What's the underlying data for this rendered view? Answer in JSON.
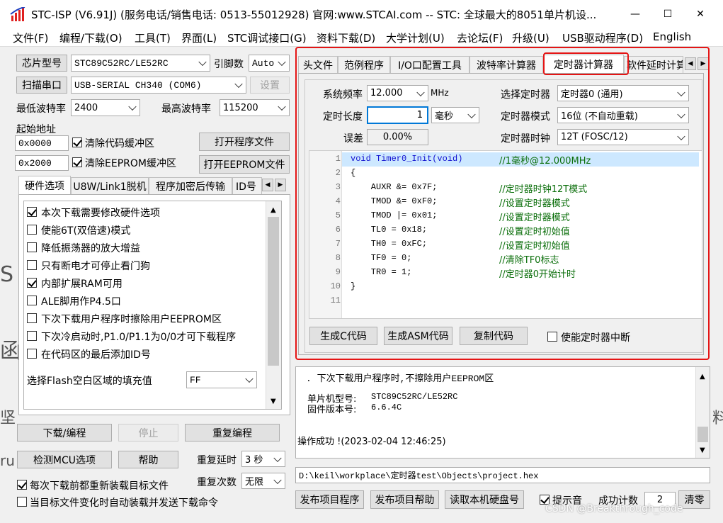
{
  "window": {
    "title": "STC-ISP (V6.91J) (服务电话/销售电话: 0513-55012928) 官网:www.STCAI.com  -- STC: 全球最大的8051单片机设...",
    "minimize": "—",
    "maximize": "☐",
    "close": "✕"
  },
  "menu": [
    "文件(F)",
    "编程/下载(O)",
    "工具(T)",
    "界面(L)",
    "STC调试接口(G)",
    "资料下载(D)",
    "大学计划(U)",
    "去论坛(F)",
    "升级(U)",
    "USB驱动程序(D)",
    "English"
  ],
  "left": {
    "chip_button": "芯片型号",
    "chip_value": "STC89C52RC/LE52RC",
    "pins_label": "引脚数",
    "pins_value": "Auto",
    "scan_button": "扫描串口",
    "port_value": "USB-SERIAL CH340 (COM6)",
    "settings_button": "设置",
    "min_baud_label": "最低波特率",
    "min_baud_value": "2400",
    "max_baud_label": "最高波特率",
    "max_baud_value": "115200",
    "start_addr_label": "起始地址",
    "addr1": "0x0000",
    "clear_code_label": "清除代码缓冲区",
    "open_program_button": "打开程序文件",
    "addr2": "0x2000",
    "clear_eeprom_label": "清除EEPROM缓冲区",
    "open_eeprom_button": "打开EEPROM文件",
    "tabs": [
      "硬件选项",
      "U8W/Link1脱机",
      "程序加密后传输",
      "ID号"
    ],
    "options": [
      {
        "label": "本次下载需要修改硬件选项",
        "checked": true
      },
      {
        "label": "使能6T(双倍速)模式",
        "checked": false
      },
      {
        "label": "降低振荡器的放大增益",
        "checked": false
      },
      {
        "label": "只有断电才可停止看门狗",
        "checked": false
      },
      {
        "label": "内部扩展RAM可用",
        "checked": true
      },
      {
        "label": "ALE脚用作P4.5口",
        "checked": false
      },
      {
        "label": "下次下载用户程序时擦除用户EEPROM区",
        "checked": false
      },
      {
        "label": "下次冷启动时,P1.0/P1.1为0/0才可下载程序",
        "checked": false
      },
      {
        "label": "在代码区的最后添加ID号",
        "checked": false
      }
    ],
    "fill_label": "选择Flash空白区域的填充值",
    "fill_value": "FF",
    "download_button": "下载/编程",
    "stop_button": "停止",
    "repeat_button": "重复编程",
    "check_mcu_button": "检测MCU选项",
    "help_button": "帮助",
    "repeat_delay_label": "重复延时",
    "repeat_delay_value": "3 秒",
    "repeat_count_label": "重复次数",
    "repeat_count_value": "无限",
    "reload_label": "每次下载前都重新装载目标文件",
    "auto_load_label": "当目标文件变化时自动装载并发送下载命令"
  },
  "right": {
    "tabs": [
      "头文件",
      "范例程序",
      "I/O口配置工具",
      "波特率计算器",
      "定时器计算器",
      "软件延时计算器"
    ],
    "sys_freq_label": "系统频率",
    "sys_freq_value": "12.000",
    "freq_unit": "MHz",
    "select_timer_label": "选择定时器",
    "select_timer_value": "定时器0 (通用)",
    "timer_len_label": "定时长度",
    "timer_len_value": "1",
    "timer_len_unit": "毫秒",
    "timer_mode_label": "定时器模式",
    "timer_mode_value": "16位 (不自动重载)",
    "error_label": "误差",
    "error_value": "0.00%",
    "timer_clock_label": "定时器时钟",
    "timer_clock_value": "12T (FOSC/12)",
    "code_lines": [
      {
        "n": "1",
        "code": "void Timer0_Init(void)",
        "comment": "//1毫秒@12.000MHz"
      },
      {
        "n": "2",
        "code": "{",
        "comment": ""
      },
      {
        "n": "3",
        "code": "    AUXR &= 0x7F;",
        "comment": "//定时器时钟12T模式"
      },
      {
        "n": "4",
        "code": "    TMOD &= 0xF0;",
        "comment": "//设置定时器模式"
      },
      {
        "n": "5",
        "code": "    TMOD |= 0x01;",
        "comment": "//设置定时器模式"
      },
      {
        "n": "6",
        "code": "    TL0 = 0x18;",
        "comment": "//设置定时初始值"
      },
      {
        "n": "7",
        "code": "    TH0 = 0xFC;",
        "comment": "//设置定时初始值"
      },
      {
        "n": "8",
        "code": "    TF0 = 0;",
        "comment": "//清除TF0标志"
      },
      {
        "n": "9",
        "code": "    TR0 = 1;",
        "comment": "//定时器0开始计时"
      },
      {
        "n": "10",
        "code": "}",
        "comment": ""
      },
      {
        "n": "11",
        "code": "",
        "comment": ""
      }
    ],
    "gen_c_button": "生成C代码",
    "gen_asm_button": "生成ASM代码",
    "copy_button": "复制代码",
    "enable_int_label": "使能定时器中断",
    "log_line1": ". 下次下载用户程序时,不擦除用户EEPROM区",
    "log_chip_label": "单片机型号:",
    "log_chip_value": "STC89C52RC/LE52RC",
    "log_fw_label": "固件版本号:",
    "log_fw_value": "6.6.4C",
    "log_success": "操作成功 !(2023-02-04 12:46:25)",
    "file_path": "D:\\keil\\workplace\\定时器test\\Objects\\project.hex",
    "publish_program_button": "发布项目程序",
    "publish_help_button": "发布项目帮助",
    "read_disk_button": "读取本机硬盘号",
    "beep_label": "提示音",
    "success_count_label": "成功计数",
    "success_count_value": "2",
    "clear_button": "清零"
  },
  "watermark": "CSDN @Breakthrough_code",
  "bg_chars": [
    "S",
    "函",
    "坚",
    "ru",
    "料"
  ],
  "colors": {
    "highlight": "#e51515",
    "line_highlight": "#cde8ff",
    "comment": "#0a6e0a",
    "keyword": "#1010d0"
  }
}
